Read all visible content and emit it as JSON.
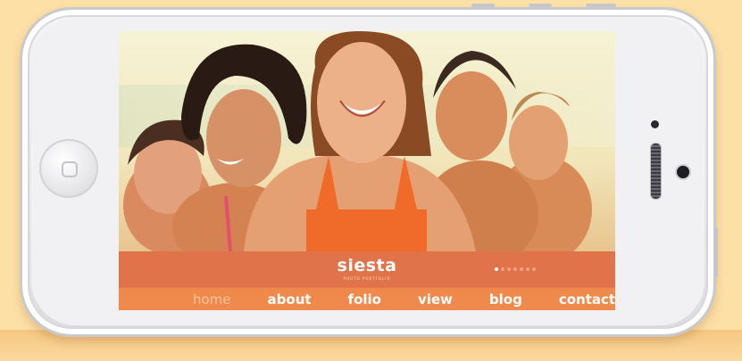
{
  "site": {
    "logo": "siesta",
    "tagline": "PHOTO PORTFOLIO",
    "slider": {
      "total": 7,
      "active_index": 0
    }
  },
  "nav": {
    "items": [
      {
        "label": "home",
        "active": true
      },
      {
        "label": "about",
        "active": false
      },
      {
        "label": "folio",
        "active": false
      },
      {
        "label": "view",
        "active": false
      },
      {
        "label": "blog",
        "active": false
      },
      {
        "label": "contacts",
        "active": false
      }
    ]
  },
  "hero_image": {
    "icon": "photo-of-smiling-friends-on-beach"
  },
  "colors": {
    "background": "#fde0a6",
    "brand_bar": "#e0734a",
    "nav_bar": "#ef8a4c",
    "nav_active": "#fcc3a0",
    "nav_text": "#ffffff"
  }
}
